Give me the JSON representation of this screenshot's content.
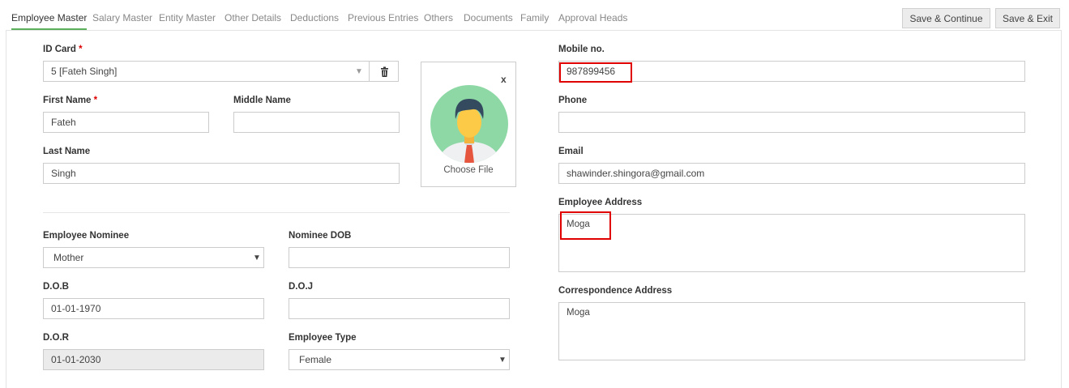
{
  "tabs": [
    {
      "label": "Employee Master",
      "active": true
    },
    {
      "label": "Salary Master"
    },
    {
      "label": "Entity Master"
    },
    {
      "label": "Other Details"
    },
    {
      "label": "Deductions"
    },
    {
      "label": "Previous Entries"
    },
    {
      "label": "Others"
    },
    {
      "label": "Documents"
    },
    {
      "label": "Family"
    },
    {
      "label": "Approval Heads"
    }
  ],
  "buttons": {
    "save_continue": "Save & Continue",
    "save_exit": "Save & Exit"
  },
  "required_mark": "*",
  "form": {
    "id_card": {
      "label": "ID Card",
      "value": "5 [Fateh Singh]"
    },
    "first_name": {
      "label": "First Name",
      "value": "Fateh"
    },
    "middle_name": {
      "label": "Middle Name",
      "value": ""
    },
    "last_name": {
      "label": "Last Name",
      "value": "Singh"
    },
    "photo": {
      "close": "x",
      "choose_file": "Choose File"
    },
    "employee_nominee": {
      "label": "Employee Nominee",
      "value": "Mother"
    },
    "nominee_dob": {
      "label": "Nominee DOB",
      "value": ""
    },
    "dob": {
      "label": "D.O.B",
      "value": "01-01-1970"
    },
    "doj": {
      "label": "D.O.J",
      "value": ""
    },
    "dor": {
      "label": "D.O.R",
      "value": "01-01-2030"
    },
    "employee_type": {
      "label": "Employee Type",
      "value": "Female"
    },
    "mobile": {
      "label": "Mobile no.",
      "value": "987899456"
    },
    "phone": {
      "label": "Phone",
      "value": ""
    },
    "email": {
      "label": "Email",
      "value": "shawinder.shingora@gmail.com"
    },
    "employee_address": {
      "label": "Employee Address",
      "value": "Moga"
    },
    "correspondence_address": {
      "label": "Correspondence Address",
      "value": "Moga"
    }
  },
  "colors": {
    "active_tab": "#5bb05b",
    "highlight": "#e00000",
    "required": "#dd0000"
  }
}
